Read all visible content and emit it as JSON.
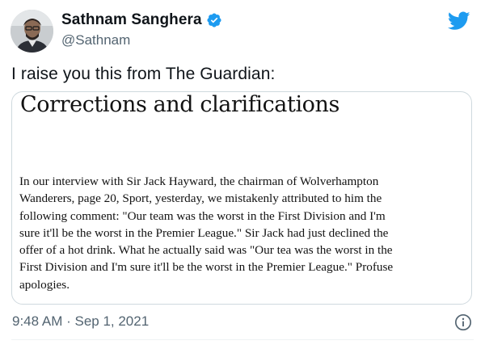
{
  "author": {
    "display_name": "Sathnam Sanghera",
    "handle": "@Sathnam",
    "verified": true
  },
  "tweet": {
    "text": "I raise you this from The Guardian:"
  },
  "card": {
    "title": "Corrections and clarifications",
    "body_lines": [
      "In our interview with Sir Jack Hayward, the chairman of Wolverhampton",
      "Wanderers, page 20, Sport, yesterday, we mistakenly attributed to him the",
      "following comment: \"Our team was the worst in the First Division and I'm",
      "sure it'll be the worst in the Premier League.\" Sir Jack had just declined the",
      "offer of a hot drink. What he actually said was \"Our tea was the worst in the",
      "First Division and I'm sure it'll be the worst in the Premier League.\" Profuse",
      "apologies."
    ]
  },
  "footer": {
    "timestamp": "9:48 AM · Sep 1, 2021"
  },
  "icons": {
    "verified": "verified-badge-icon",
    "brand": "twitter-bird-icon",
    "info": "info-icon"
  },
  "colors": {
    "twitter_blue": "#1d9bf0",
    "secondary_text": "#536471",
    "card_border": "#cfd9de"
  }
}
